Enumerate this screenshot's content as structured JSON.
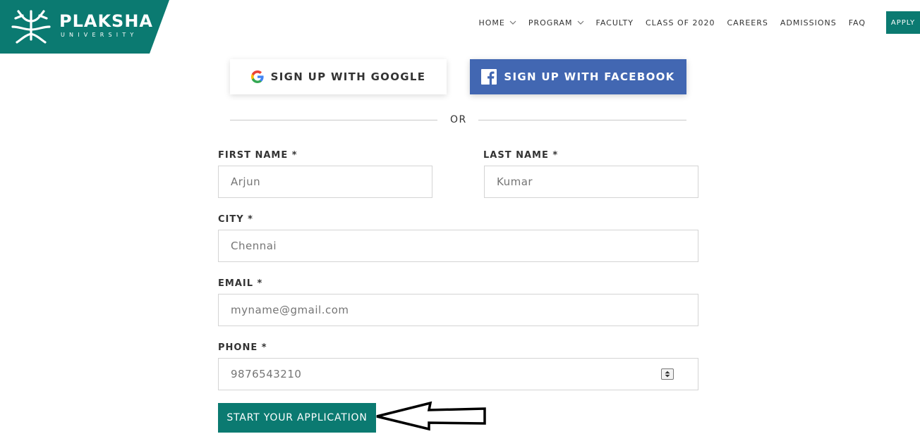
{
  "brand": {
    "name": "PLAKSHA",
    "subtitle": "UNIVERSITY",
    "color": "#0b7a71"
  },
  "nav": {
    "items": [
      {
        "label": "HOME",
        "dropdown": true
      },
      {
        "label": "PROGRAM",
        "dropdown": true
      },
      {
        "label": "FACULTY",
        "dropdown": false
      },
      {
        "label": "CLASS OF 2020",
        "dropdown": false
      },
      {
        "label": "CAREERS",
        "dropdown": false
      },
      {
        "label": "ADMISSIONS",
        "dropdown": false
      },
      {
        "label": "FAQ",
        "dropdown": false
      }
    ],
    "apply_label": "APPLY"
  },
  "social": {
    "google_label": "SIGN UP WITH GOOGLE",
    "facebook_label": "SIGN UP WITH FACEBOOK",
    "facebook_color": "#4267b2"
  },
  "separator": {
    "label": "OR"
  },
  "form": {
    "first_name": {
      "label": "FIRST NAME *",
      "placeholder": "Arjun"
    },
    "last_name": {
      "label": "LAST NAME *",
      "placeholder": "Kumar"
    },
    "city": {
      "label": "CITY *",
      "placeholder": "Chennai"
    },
    "email": {
      "label": "EMAIL *",
      "placeholder": "myname@gmail.com"
    },
    "phone": {
      "label": "PHONE *",
      "placeholder": "9876543210"
    },
    "submit_label": "START YOUR APPLICATION"
  }
}
